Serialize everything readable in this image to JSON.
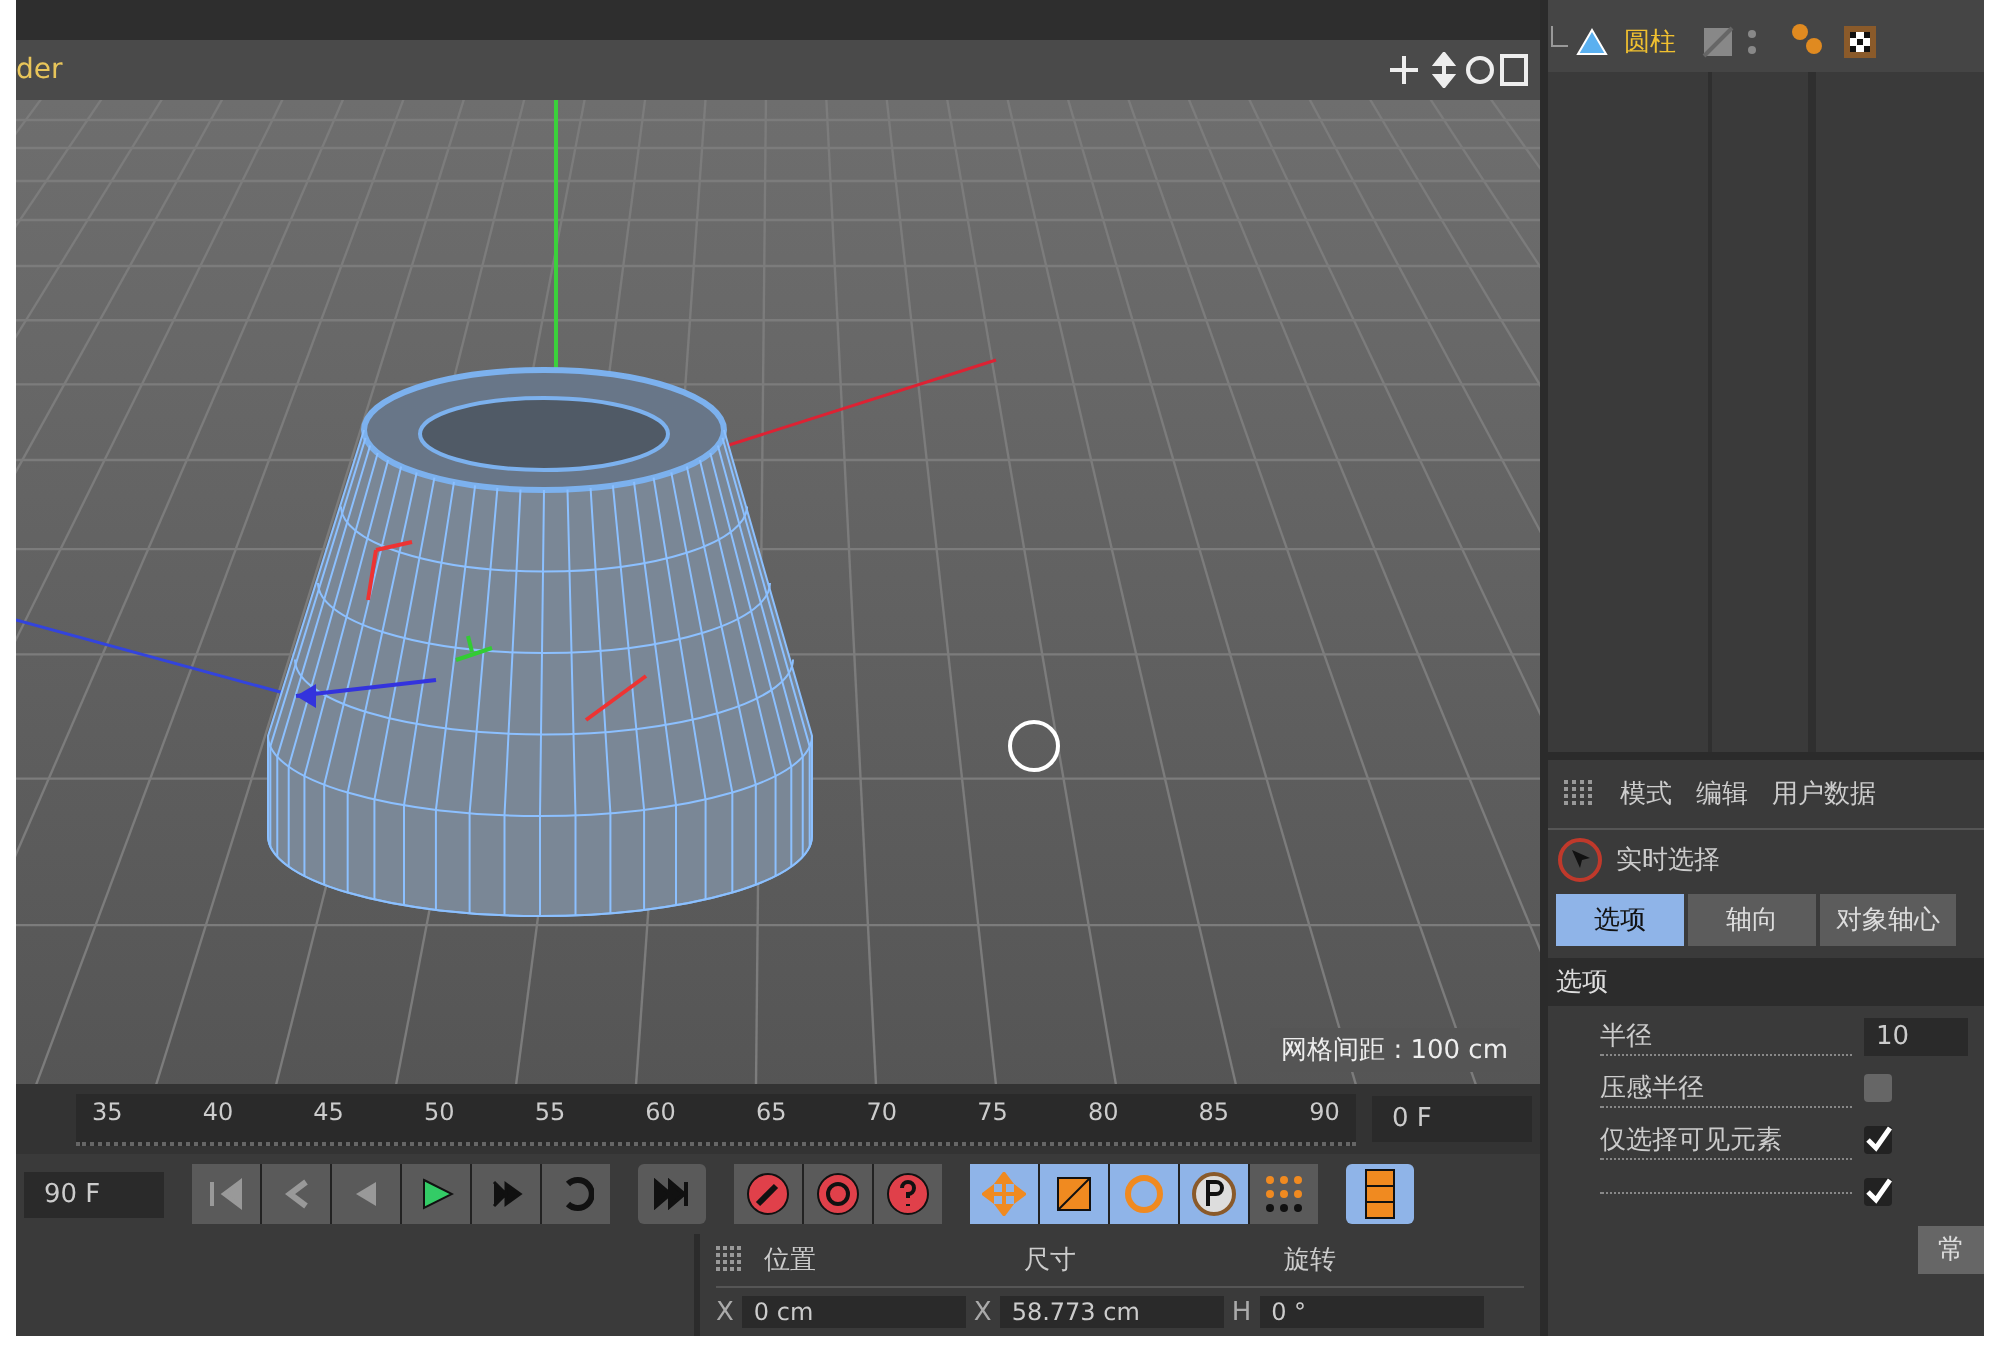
{
  "viewport": {
    "menu_label": "der",
    "grid_spacing": "网格间距 : 100 cm"
  },
  "object_manager": {
    "objects": [
      {
        "name": "圆柱",
        "selected": true
      }
    ]
  },
  "attributes": {
    "menu": [
      "模式",
      "编辑",
      "用户数据"
    ],
    "tool": "实时选择",
    "tabs": [
      {
        "label": "选项",
        "selected": true
      },
      {
        "label": "轴向",
        "selected": false
      },
      {
        "label": "对象轴心",
        "selected": false
      }
    ],
    "section": "选项",
    "fields": [
      {
        "kind": "number",
        "label": "半径",
        "value": "10"
      },
      {
        "kind": "checkbox",
        "label": "压感半径",
        "checked": false
      },
      {
        "kind": "checkbox",
        "label": "仅选择可见元素",
        "checked": true
      },
      {
        "kind": "checkbox",
        "checked": true
      }
    ],
    "mode_button": "常"
  },
  "timeline": {
    "ticks": [
      "35",
      "40",
      "45",
      "50",
      "55",
      "60",
      "65",
      "70",
      "75",
      "80",
      "85",
      "90"
    ],
    "current_frame": "0 F"
  },
  "transport": {
    "end_frame": "90 F"
  },
  "coordinates": {
    "columns": [
      "位置",
      "尺寸",
      "旋转"
    ],
    "fields": [
      {
        "axis": "X",
        "value": "0 cm"
      },
      {
        "axis": "X",
        "value": "58.773 cm"
      },
      {
        "axis": "H",
        "value": "0 °"
      }
    ]
  }
}
